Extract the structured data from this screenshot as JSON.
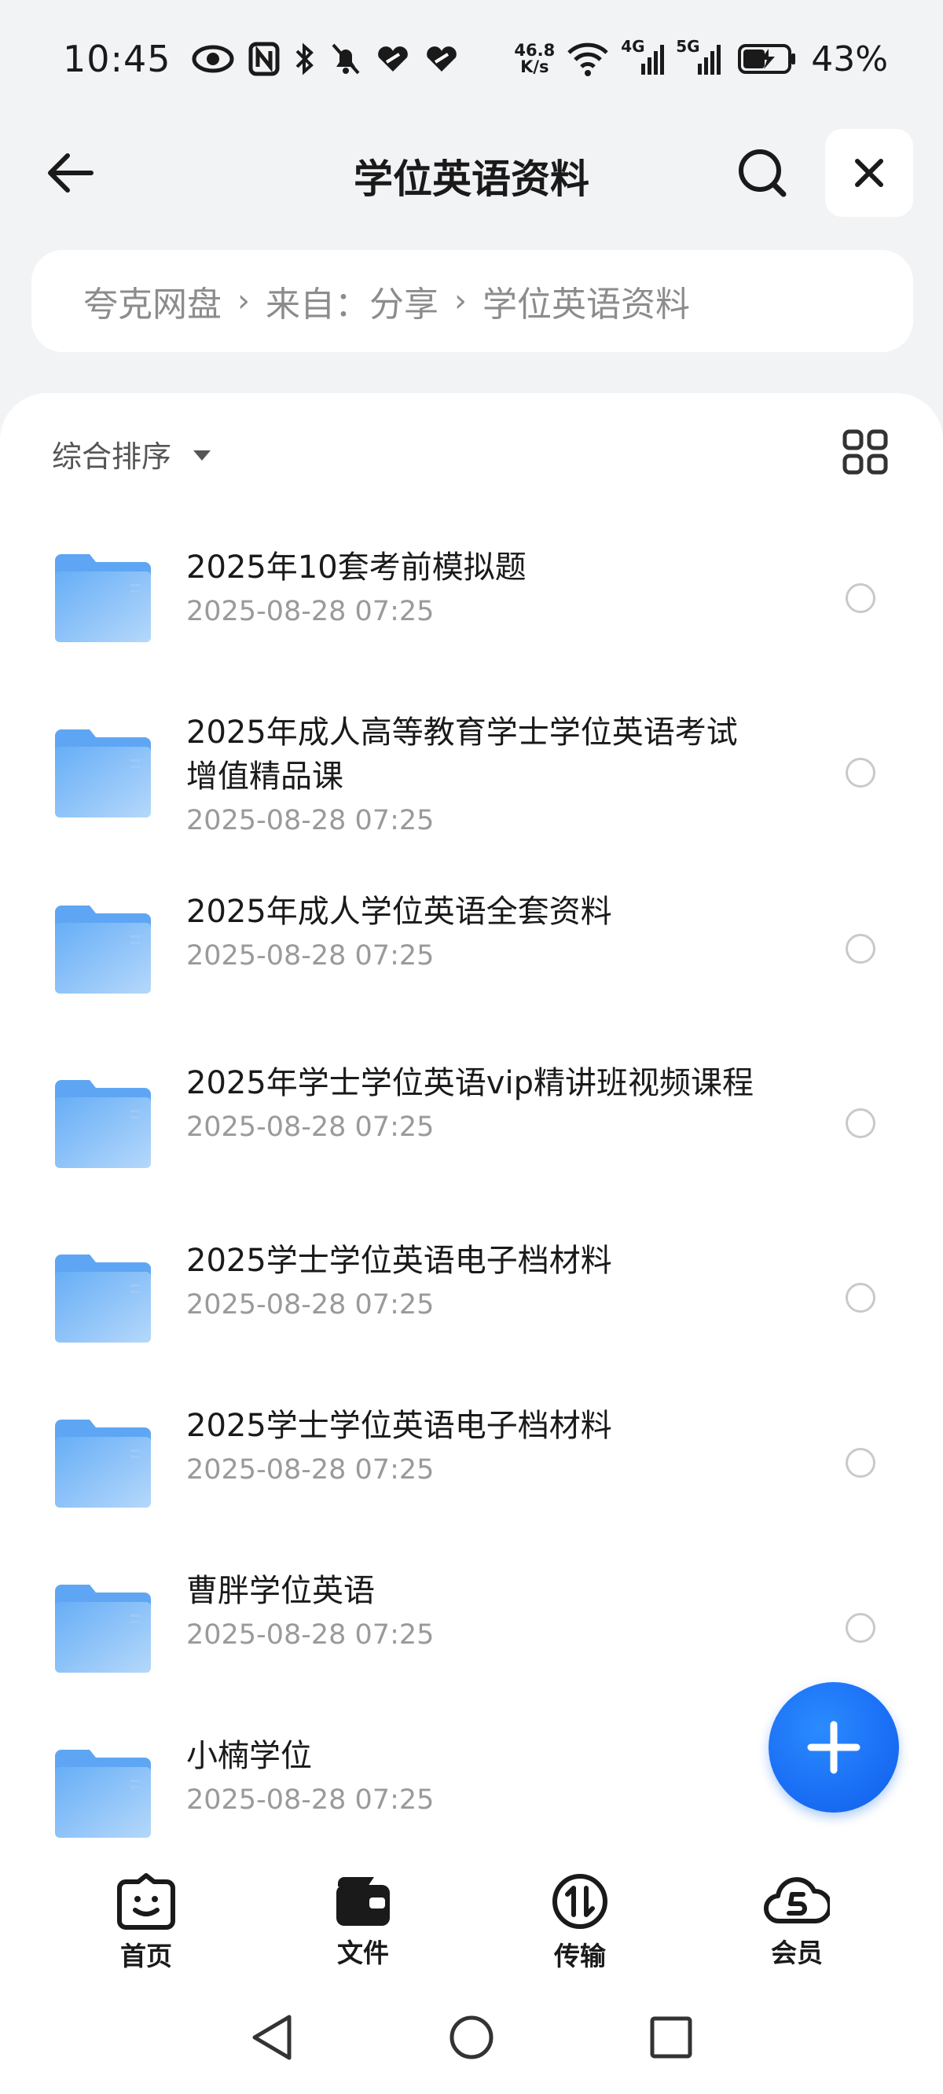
{
  "status_bar": {
    "time": "10:45",
    "net_speed_value": "46.8",
    "net_speed_unit": "K/s",
    "net1": "4G",
    "net2": "5G",
    "battery": "43%",
    "icons": [
      "eye-icon",
      "nfc-icon",
      "bluetooth-icon",
      "mute-bell-icon",
      "heart-link-icon",
      "heart-link-icon",
      "wifi-icon",
      "signal-icon",
      "signal-icon",
      "battery-charging-icon"
    ]
  },
  "header": {
    "title": "学位英语资料"
  },
  "breadcrumb": {
    "items": [
      "夸克网盘",
      "来自：分享",
      "学位英语资料"
    ]
  },
  "toolbar": {
    "sort_label": "综合排序"
  },
  "files": [
    {
      "name": "2025年10套考前模拟题",
      "date": "2025-08-28 07:25"
    },
    {
      "name": "2025年成人高等教育学士学位英语考试增值精品课",
      "date": "2025-08-28 07:25"
    },
    {
      "name": "2025年成人学位英语全套资料",
      "date": "2025-08-28 07:25"
    },
    {
      "name": "2025年学士学位英语vip精讲班视频课程",
      "date": "2025-08-28 07:25"
    },
    {
      "name": "2025学士学位英语电子档材料",
      "date": "2025-08-28 07:25"
    },
    {
      "name": "2025学士学位英语电子档材料",
      "date": "2025-08-28 07:25"
    },
    {
      "name": "曹胖学位英语",
      "date": "2025-08-28 07:25"
    },
    {
      "name": "小楠学位",
      "date": "2025-08-28 07:25"
    }
  ],
  "bottom_nav": {
    "items": [
      {
        "label": "首页",
        "icon": "smiley-icon"
      },
      {
        "label": "文件",
        "icon": "wallet-folder-icon"
      },
      {
        "label": "传输",
        "icon": "transfer-icon"
      },
      {
        "label": "会员",
        "icon": "cloud-s-icon"
      }
    ]
  },
  "colors": {
    "accent": "#1a6ff5",
    "folder": "#7dbaf7",
    "background": "#f2f3f5"
  }
}
